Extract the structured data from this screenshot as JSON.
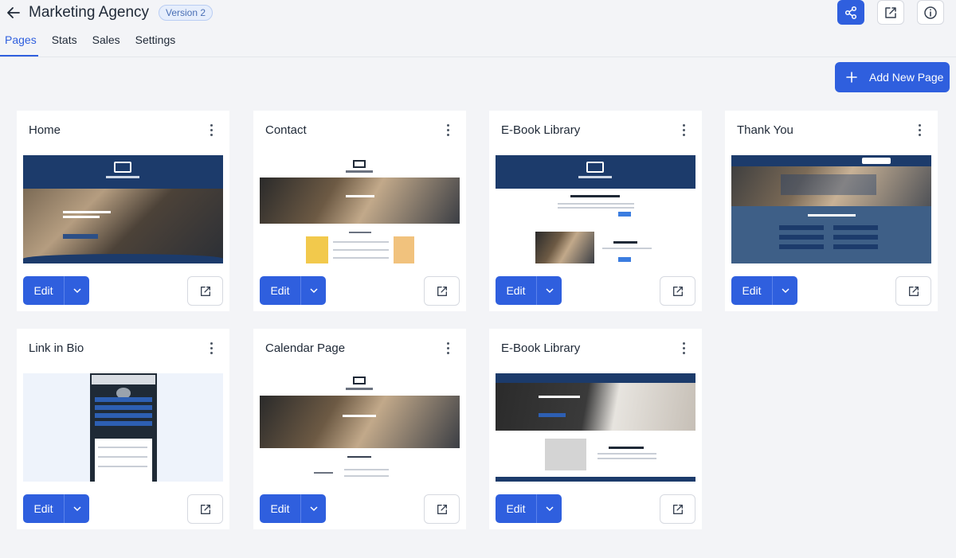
{
  "header": {
    "title": "Marketing Agency",
    "version": "Version 2",
    "tabs": [
      "Pages",
      "Stats",
      "Sales",
      "Settings"
    ],
    "active_tab": "Pages"
  },
  "actions": {
    "add_page": "Add New Page"
  },
  "cards": [
    {
      "title": "Home",
      "edit": "Edit"
    },
    {
      "title": "Contact",
      "edit": "Edit"
    },
    {
      "title": "E-Book Library",
      "edit": "Edit"
    },
    {
      "title": "Thank You",
      "edit": "Edit"
    },
    {
      "title": "Link in Bio",
      "edit": "Edit"
    },
    {
      "title": "Calendar Page",
      "edit": "Edit"
    },
    {
      "title": "E-Book Library",
      "edit": "Edit"
    }
  ],
  "colors": {
    "accent": "#2f5fde",
    "navy": "#1c3b6b",
    "background": "#f3f4f7"
  },
  "icons": {
    "back": "arrow-left-icon",
    "share": "share-icon",
    "open": "external-link-icon",
    "info": "info-icon",
    "add": "plus-icon",
    "menu": "kebab-icon",
    "dropdown": "chevron-down-icon"
  }
}
